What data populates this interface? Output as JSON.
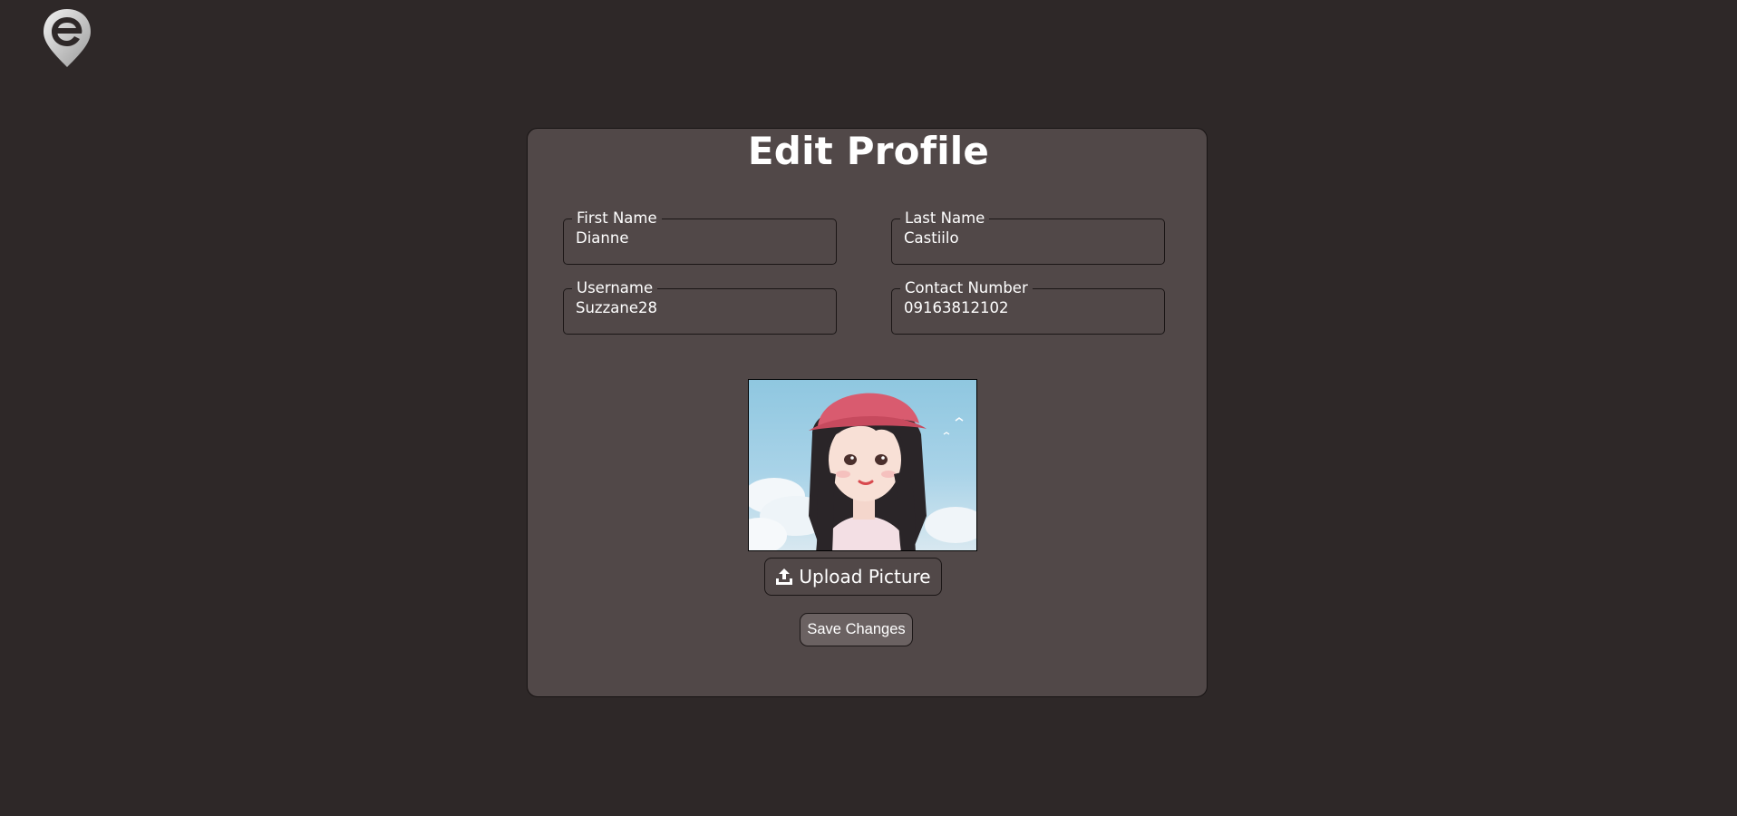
{
  "app": {
    "logo_icon": "map-pin-e-logo-icon"
  },
  "profile": {
    "title": "Edit Profile",
    "fields": {
      "first_name": {
        "label": "First Name",
        "value": "Dianne"
      },
      "last_name": {
        "label": "Last Name",
        "value": "Castiilo"
      },
      "username": {
        "label": "Username",
        "value": "Suzzane28"
      },
      "contact_number": {
        "label": "Contact Number",
        "value": "09163812102"
      }
    },
    "picture_icon": "profile-picture",
    "upload": {
      "label": "Upload Picture",
      "icon": "upload-icon"
    },
    "save": {
      "label": "Save Changes"
    }
  },
  "colors": {
    "background": "#2e2828",
    "card": "#514848",
    "card_border": "#181414",
    "text": "#ffffff",
    "save_button": "#6b6262"
  }
}
